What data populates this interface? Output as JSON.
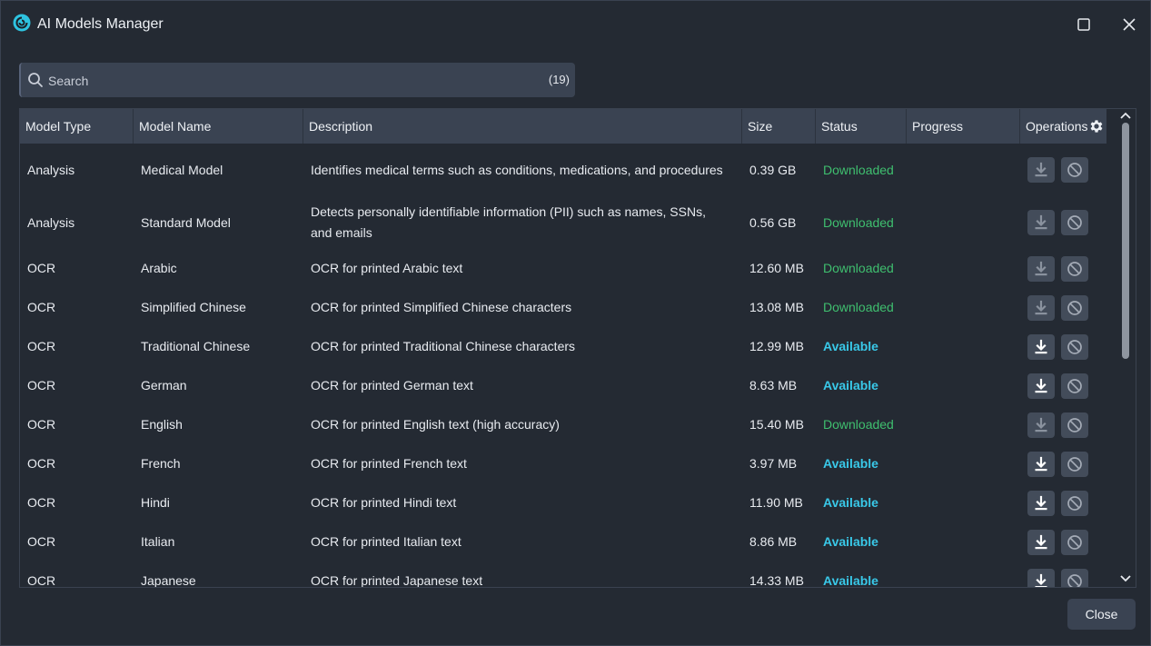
{
  "window": {
    "title": "AI Models Manager",
    "accent_color": "#2ec3e0"
  },
  "search": {
    "placeholder": "Search",
    "value": "",
    "count": "(19)"
  },
  "table": {
    "columns": [
      "Model Type",
      "Model Name",
      "Description",
      "Size",
      "Status",
      "Progress",
      "Operations"
    ],
    "rows": [
      {
        "type": "Analysis",
        "name": "Medical Model",
        "description": "Identifies medical terms such as conditions, medications, and procedures",
        "size": "0.39 GB",
        "status": "Downloaded",
        "progress": ""
      },
      {
        "type": "Analysis",
        "name": "Standard Model",
        "description": "Detects personally identifiable information (PII) such as names, SSNs, and emails",
        "size": "0.56 GB",
        "status": "Downloaded",
        "progress": ""
      },
      {
        "type": "OCR",
        "name": "Arabic",
        "description": "OCR for printed Arabic text",
        "size": "12.60 MB",
        "status": "Downloaded",
        "progress": ""
      },
      {
        "type": "OCR",
        "name": "Simplified Chinese",
        "description": "OCR for printed Simplified Chinese characters",
        "size": "13.08 MB",
        "status": "Downloaded",
        "progress": ""
      },
      {
        "type": "OCR",
        "name": "Traditional Chinese",
        "description": "OCR for printed Traditional Chinese characters",
        "size": "12.99 MB",
        "status": "Available",
        "progress": ""
      },
      {
        "type": "OCR",
        "name": "German",
        "description": "OCR for printed German text",
        "size": "8.63 MB",
        "status": "Available",
        "progress": ""
      },
      {
        "type": "OCR",
        "name": "English",
        "description": "OCR for printed English text (high accuracy)",
        "size": "15.40 MB",
        "status": "Downloaded",
        "progress": ""
      },
      {
        "type": "OCR",
        "name": "French",
        "description": "OCR for printed French text",
        "size": "3.97 MB",
        "status": "Available",
        "progress": ""
      },
      {
        "type": "OCR",
        "name": "Hindi",
        "description": "OCR for printed Hindi text",
        "size": "11.90 MB",
        "status": "Available",
        "progress": ""
      },
      {
        "type": "OCR",
        "name": "Italian",
        "description": "OCR for printed Italian text",
        "size": "8.86 MB",
        "status": "Available",
        "progress": ""
      },
      {
        "type": "OCR",
        "name": "Japanese",
        "description": "OCR for printed Japanese text",
        "size": "14.33 MB",
        "status": "Available",
        "progress": ""
      }
    ]
  },
  "icons": {
    "app": "app-logo-icon",
    "search": "search-icon",
    "settings": "gear-icon",
    "download": "download-icon",
    "cancel": "cancel-icon",
    "maximize": "maximize-icon",
    "close": "close-icon"
  },
  "colors": {
    "downloaded": "#3fbf6f",
    "available": "#39c8e8"
  },
  "footer": {
    "close_label": "Close"
  }
}
